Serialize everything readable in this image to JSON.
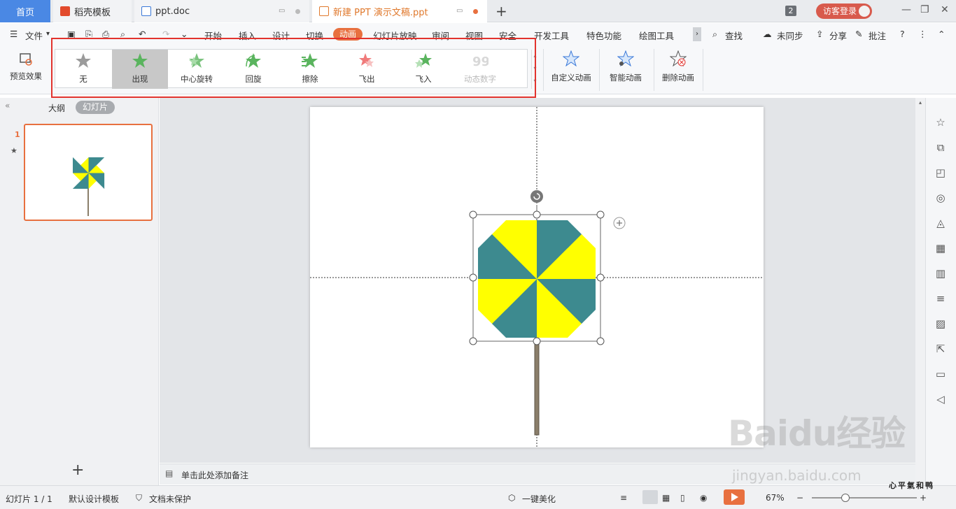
{
  "tabs": {
    "home": "首页",
    "t1": "稻壳模板",
    "t2": "ppt.doc",
    "t3": "新建 PPT 演示文稿.ppt"
  },
  "window": {
    "count": "2",
    "login": "访客登录"
  },
  "menu": {
    "file": "文件",
    "items": [
      "开始",
      "插入",
      "设计",
      "切换",
      "动画",
      "幻灯片放映",
      "审阅",
      "视图",
      "安全",
      "开发工具",
      "特色功能",
      "绘图工具"
    ],
    "find": "查找",
    "sync": "未同步",
    "share": "分享",
    "comment": "批注"
  },
  "ribbon": {
    "preview": "预览效果",
    "gallery": [
      "无",
      "出现",
      "中心旋转",
      "回旋",
      "擦除",
      "飞出",
      "飞入",
      "动态数字"
    ],
    "selected_index": 1,
    "custom": "自定义动画",
    "smart": "智能动画",
    "delete": "删除动画"
  },
  "leftpane": {
    "outline": "大纲",
    "slides": "幻灯片",
    "slide_number": "1"
  },
  "notes": {
    "placeholder": "单击此处添加备注"
  },
  "status": {
    "slide": "幻灯片 1 / 1",
    "template": "默认设计模板",
    "protect": "文档未保护",
    "beautify": "一键美化",
    "zoom": "67%"
  },
  "watermark": {
    "brand": "Baidu经验",
    "url": "jingyan.baidu.com",
    "caption": "心平氣和鸭"
  },
  "colors": {
    "accent": "#e8703f",
    "teal": "#3d8a8f",
    "yellow": "#ffff00",
    "stick": "#8a7e6a",
    "red": "#e2332e"
  }
}
